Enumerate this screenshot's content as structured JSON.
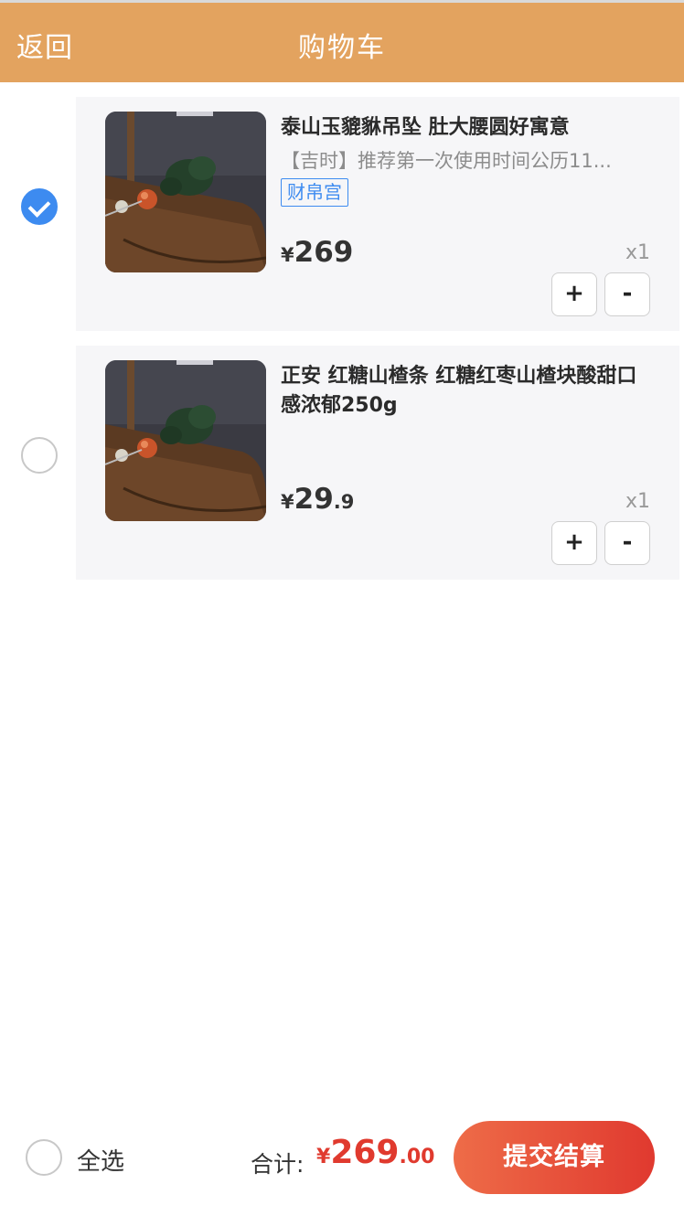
{
  "navbar": {
    "back_label": "返回",
    "title": "购物车",
    "background": "#e3a35f"
  },
  "cart": {
    "items": [
      {
        "selected": true,
        "name": "泰山玉貔貅吊坠 肚大腰圆好寓意",
        "description": "【吉时】推荐第一次使用时间公历11...",
        "tag": "财帛宫",
        "price_symbol": "¥",
        "price_integer": "269",
        "price_decimal": "",
        "quantity_label": "x1",
        "plus_label": "+",
        "minus_label": "-",
        "image_icon": "jade-pixiu-pendant-image"
      },
      {
        "selected": false,
        "name": "正安 红糖山楂条 红糖红枣山楂块酸甜口感浓郁250g",
        "description": "",
        "tag": "",
        "price_symbol": "¥",
        "price_integer": "29",
        "price_decimal": ".9",
        "quantity_label": "x1",
        "plus_label": "+",
        "minus_label": "-",
        "image_icon": "jade-pixiu-pendant-image"
      }
    ]
  },
  "footer": {
    "select_all_label": "全选",
    "total_label": "合计:",
    "total_symbol": "¥",
    "total_integer": "269",
    "total_decimal": ".00",
    "submit_label": "提交结算"
  },
  "colors": {
    "accent_blue": "#3d8bf0",
    "price_red": "#e03a2e",
    "submit_gradient_start": "#ee6c48",
    "submit_gradient_end": "#e0392f",
    "card_background": "#f6f6f8"
  }
}
